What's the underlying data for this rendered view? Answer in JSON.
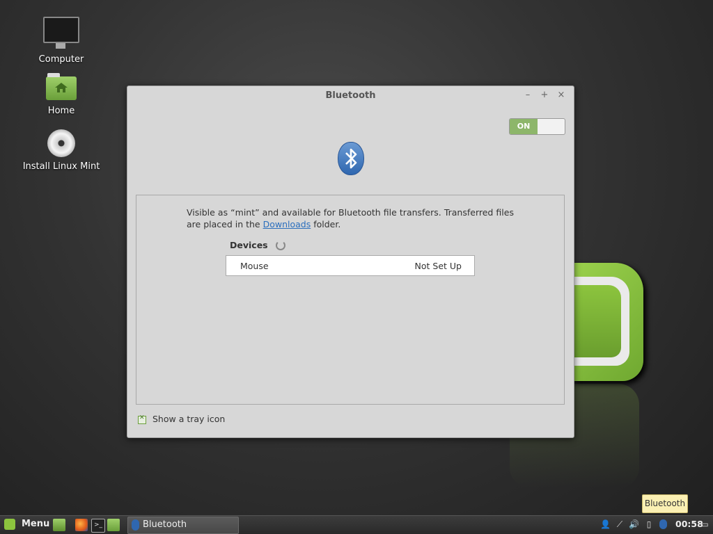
{
  "desktop": {
    "icons": [
      {
        "label": "Computer"
      },
      {
        "label": "Home"
      },
      {
        "label": "Install Linux Mint"
      }
    ]
  },
  "window": {
    "title": "Bluetooth",
    "controls": {
      "minimize": "–",
      "maximize": "+",
      "close": "×"
    },
    "toggle_label": "ON",
    "description_before": "Visible as “mint” and available for Bluetooth file transfers. Transferred files are placed in the ",
    "description_link": "Downloads",
    "description_after": " folder.",
    "devices_heading": "Devices",
    "devices": [
      {
        "name": "Mouse",
        "status": "Not Set Up"
      }
    ],
    "tray_checkbox_label": "Show a tray icon",
    "tray_checkbox_checked": true
  },
  "tooltip": "Bluetooth",
  "taskbar": {
    "menu_label": "Menu",
    "task_label": "Bluetooth",
    "clock": "00:58"
  },
  "colors": {
    "accent": "#8db66a",
    "bluetooth": "#2f67b0",
    "link": "#2a6ebd"
  }
}
